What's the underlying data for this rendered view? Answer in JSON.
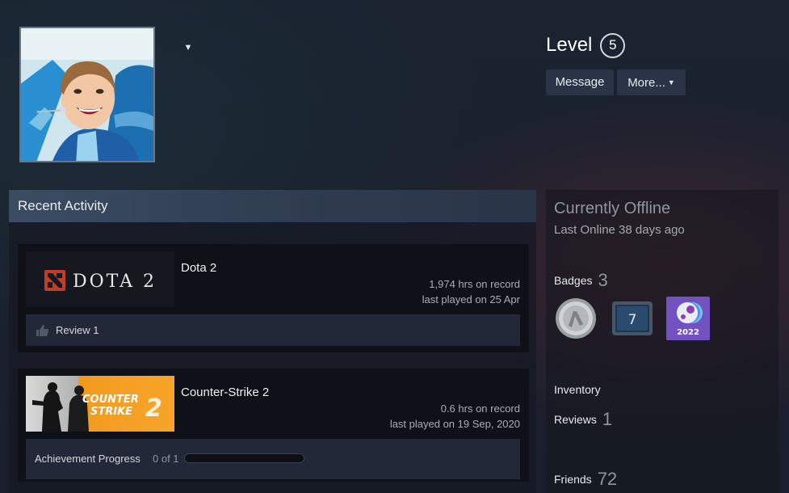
{
  "profile": {
    "level_label": "Level",
    "level_value": "5",
    "actions": {
      "message_label": "Message",
      "more_label": "More..."
    }
  },
  "recent_activity": {
    "title": "Recent Activity",
    "games": [
      {
        "capsule_text": "DOTA 2",
        "name": "Dota 2",
        "hours": "1,974 hrs on record",
        "last_played": "last played on 25 Apr",
        "footer": {
          "type": "review",
          "label": "Review 1"
        }
      },
      {
        "capsule_text": [
          "COUNTER",
          "STRIKE",
          "2"
        ],
        "name": "Counter-Strike 2",
        "hours": "0.6 hrs on record",
        "last_played": "last played on 19 Sep, 2020",
        "footer": {
          "type": "achievements",
          "label": "Achievement Progress",
          "count": "0 of 1",
          "progress": 0
        }
      }
    ]
  },
  "sidebar": {
    "status_title": "Currently Offline",
    "status_sub": "Last Online 38 days ago",
    "badges_label": "Badges",
    "badges_count": "3",
    "badges": [
      {
        "icon": "silver-coin-badge-icon"
      },
      {
        "icon": "years-of-service-badge-icon",
        "text": "7"
      },
      {
        "icon": "steam-2022-badge-icon",
        "text": "2022"
      }
    ],
    "inventory_label": "Inventory",
    "reviews_label": "Reviews",
    "reviews_count": "1",
    "friends_label": "Friends",
    "friends_count": "72"
  },
  "colors": {
    "dota_red": "#c23c2a",
    "cs_orange": "#f39a1e",
    "badge_purple": "#8a3fb8",
    "accent_blue": "#6aa7d8"
  }
}
